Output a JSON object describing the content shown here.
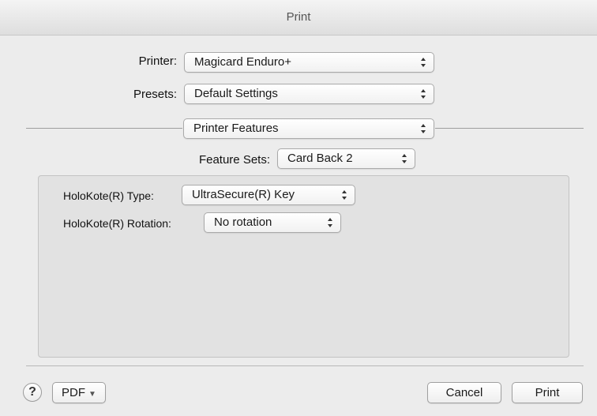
{
  "window": {
    "title": "Print"
  },
  "printer": {
    "label": "Printer:",
    "value": "Magicard Enduro+"
  },
  "presets": {
    "label": "Presets:",
    "value": "Default Settings"
  },
  "section": {
    "value": "Printer Features"
  },
  "feature_sets": {
    "label": "Feature Sets:",
    "value": "Card Back 2"
  },
  "holokote_type": {
    "label": "HoloKote(R) Type:",
    "value": "UltraSecure(R) Key"
  },
  "holokote_rotation": {
    "label": "HoloKote(R) Rotation:",
    "value": "No rotation"
  },
  "footer": {
    "help_label": "?",
    "pdf_label": "PDF",
    "pdf_caret": "▼",
    "cancel_label": "Cancel",
    "print_label": "Print"
  },
  "colors": {
    "window_bg": "#ececec",
    "panel_bg": "#e2e2e2"
  },
  "icons": [
    "popup-arrows-icon",
    "dropdown-caret-icon",
    "help-icon"
  ]
}
